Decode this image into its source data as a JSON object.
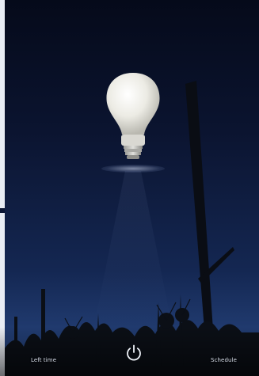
{
  "controls": {
    "left_label": "Left time",
    "right_label": "Schedule"
  },
  "icons": {
    "power": "power-icon",
    "bulb": "light-bulb-icon"
  },
  "colors": {
    "sky_top": "#050a1a",
    "sky_bottom": "#2a4a86",
    "bulb": "#f2f2ec"
  }
}
